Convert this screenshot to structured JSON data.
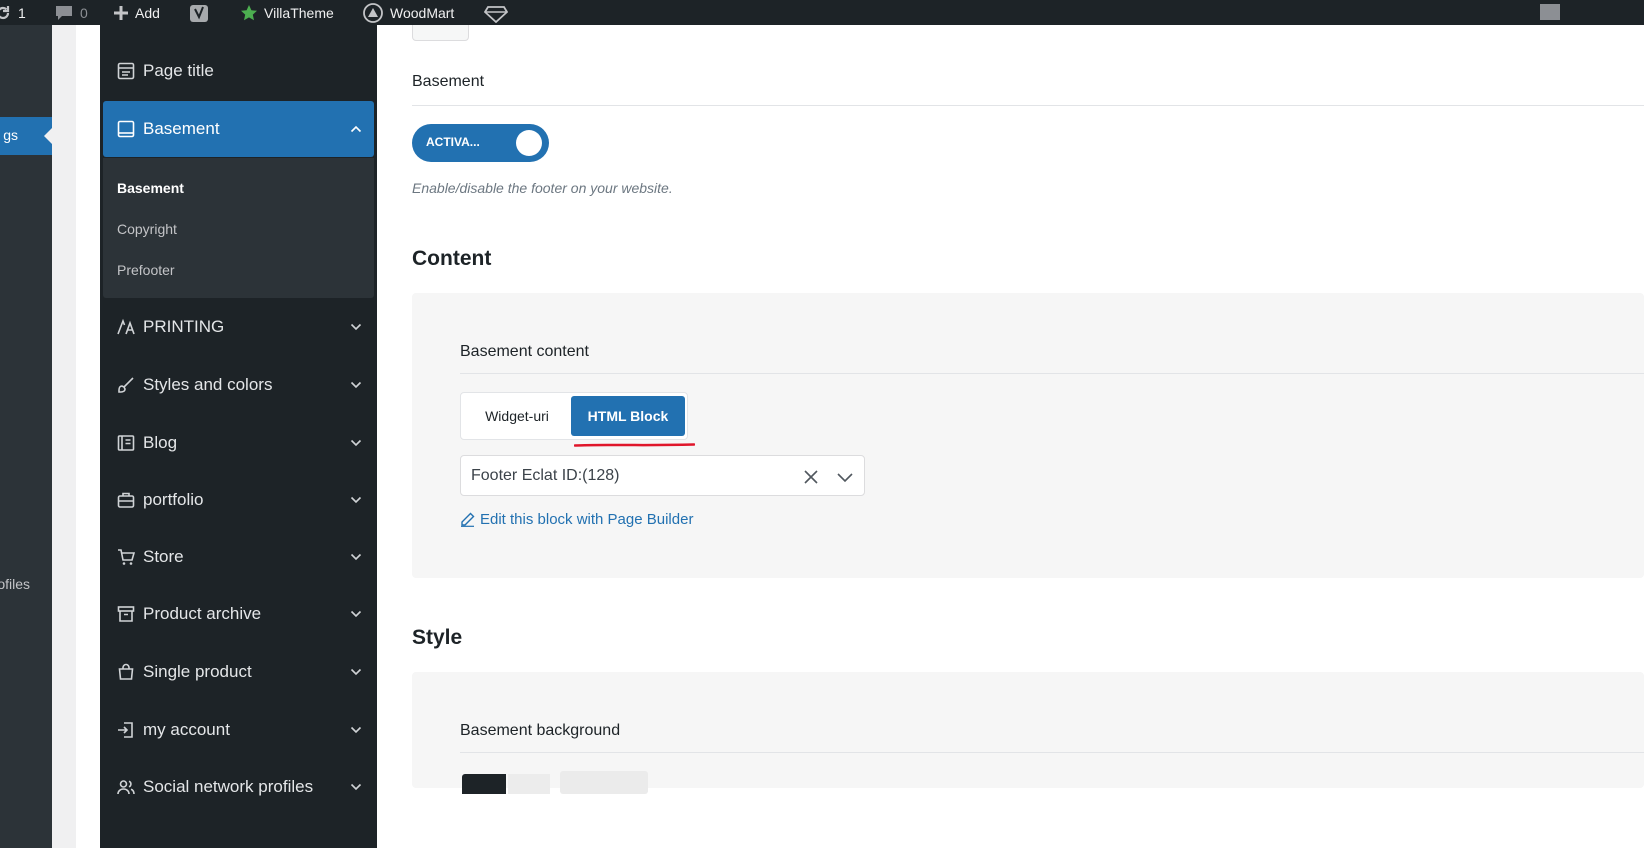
{
  "admin_bar": {
    "updates_count": "1",
    "comments_count": "0",
    "add_label": "Add",
    "villatheme_label": "VillaTheme",
    "woodmart_label": "WoodMart"
  },
  "wp_menu": {
    "current_item_partial": "gs",
    "item_partial": "ofiles"
  },
  "sidebar": {
    "items": [
      {
        "label": "Page title",
        "icon": "page-title-icon"
      },
      {
        "label": "Basement",
        "icon": "basement-icon",
        "expanded": true
      },
      {
        "label": "PRINTING",
        "icon": "typography-icon"
      },
      {
        "label": "Styles and colors",
        "icon": "brush-icon"
      },
      {
        "label": "Blog",
        "icon": "blog-icon"
      },
      {
        "label": "portfolio",
        "icon": "briefcase-icon"
      },
      {
        "label": "Store",
        "icon": "cart-icon"
      },
      {
        "label": "Product archive",
        "icon": "archive-icon"
      },
      {
        "label": "Single product",
        "icon": "bag-icon"
      },
      {
        "label": "my account",
        "icon": "login-icon"
      },
      {
        "label": "Social network profiles",
        "icon": "users-icon"
      }
    ],
    "sub_items": [
      {
        "label": "Basement",
        "current": true
      },
      {
        "label": "Copyright"
      },
      {
        "label": "Prefooter"
      }
    ]
  },
  "main": {
    "basement_field_title": "Basement",
    "toggle_label": "ACTIVA...",
    "toggle_on": true,
    "toggle_description": "Enable/disable the footer on your website.",
    "content_section_title": "Content",
    "basement_content_title": "Basement content",
    "content_options": [
      "Widget-uri",
      "HTML Block"
    ],
    "content_selected": "HTML Block",
    "html_block_select_value": "Footer Eclat ID:(128)",
    "edit_link_label": "Edit this block with Page Builder",
    "style_section_title": "Style",
    "basement_background_title": "Basement background"
  },
  "colors": {
    "accent": "#2271b1",
    "sidebar_bg": "#1d2327",
    "annotation_red": "#e0162b"
  }
}
